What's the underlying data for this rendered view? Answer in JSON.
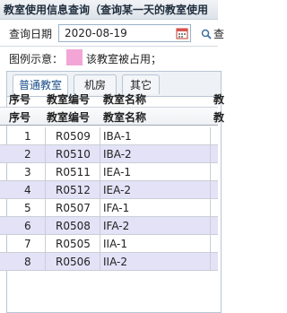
{
  "title": "教室使用信息查询（查询某一天的教室使用",
  "query": {
    "label": "查询日期",
    "date_value": "2020-08-19",
    "more_label": "查"
  },
  "legend": {
    "label": "图例示意：",
    "text": "该教室被占用；",
    "swatch_color": "#f3a6d6"
  },
  "tabs": [
    {
      "label": "普通教室",
      "active": true
    },
    {
      "label": "机房",
      "active": false
    },
    {
      "label": "其它",
      "active": false
    }
  ],
  "table": {
    "headers": [
      "序号",
      "教室编号",
      "教室名称"
    ],
    "header_overflow": "教",
    "header2_overflow": "教",
    "rows": [
      {
        "no": "1",
        "code": "R0509",
        "name": "IBA-1"
      },
      {
        "no": "2",
        "code": "R0510",
        "name": "IBA-2"
      },
      {
        "no": "3",
        "code": "R0511",
        "name": "IEA-1"
      },
      {
        "no": "4",
        "code": "R0512",
        "name": "IEA-2"
      },
      {
        "no": "5",
        "code": "R0507",
        "name": "IFA-1"
      },
      {
        "no": "6",
        "code": "R0508",
        "name": "IFA-2"
      },
      {
        "no": "7",
        "code": "R0505",
        "name": "IIA-1"
      },
      {
        "no": "8",
        "code": "R0506",
        "name": "IIA-2"
      }
    ]
  }
}
